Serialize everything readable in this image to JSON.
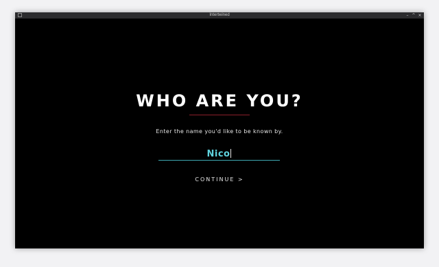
{
  "window": {
    "title": "Intertwined",
    "controls": {
      "minimize": "–",
      "maximize": "^",
      "close": "×"
    }
  },
  "screen": {
    "heading": "WHO ARE YOU?",
    "subtitle": "Enter the name you'd like to be known by.",
    "name_input": {
      "value": "Nico"
    },
    "continue_label": "CONTINUE >"
  },
  "colors": {
    "background": "#000000",
    "accent_input": "#5fd3de",
    "underline": "#3fa9b3",
    "heading_rule": "#8e1f2b",
    "text": "#ffffff"
  },
  "icons": {
    "app": "app-icon",
    "minimize": "minimize-icon",
    "maximize": "maximize-icon",
    "close": "close-icon"
  }
}
